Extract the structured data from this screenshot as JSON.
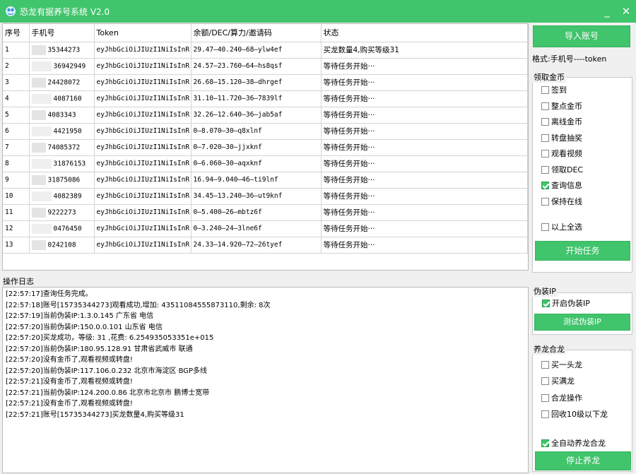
{
  "window": {
    "title": "恐龙有据养号系统 V2.0",
    "minimize": "_",
    "close": "✕"
  },
  "grid": {
    "headers": [
      "序号",
      "手机号",
      "Token",
      "余额/DEC/算力/邀请码",
      "状态"
    ],
    "rows": [
      {
        "no": "1",
        "phone": "35344273",
        "token": "eyJhbGciOiJIUzI1NiIsInR",
        "balance": "29.47—40.240—68—ylw4ef",
        "status": "买龙数量4,购买等级31"
      },
      {
        "no": "2",
        "phone": "36942949",
        "token": "eyJhbGciOiJIUzI1NiIsInR",
        "balance": "24.57—23.760—64—hs8qsf",
        "status": "等待任务开始···"
      },
      {
        "no": "3",
        "phone": "24428072",
        "token": "eyJhbGciOiJIUzI1NiIsInR",
        "balance": "26.68—15.120—38—dhrgef",
        "status": "等待任务开始···"
      },
      {
        "no": "4",
        "phone": "4087160",
        "token": "eyJhbGciOiJIUzI1NiIsInR",
        "balance": "31.10—11.720—36—7839lf",
        "status": "等待任务开始···"
      },
      {
        "no": "5",
        "phone": "4083343",
        "token": "eyJhbGciOiJIUzI1NiIsInR",
        "balance": "32.26—12.640—36—jab5af",
        "status": "等待任务开始···"
      },
      {
        "no": "6",
        "phone": "4421950",
        "token": "eyJhbGciOiJIUzI1NiIsInR",
        "balance": "0—8.070—30—q8xlnf",
        "status": "等待任务开始···"
      },
      {
        "no": "7",
        "phone": "74085372",
        "token": "eyJhbGciOiJIUzI1NiIsInR",
        "balance": "0—7.020—30—jjxknf",
        "status": "等待任务开始···"
      },
      {
        "no": "8",
        "phone": "31876153",
        "token": "eyJhbGciOiJIUzI1NiIsInR",
        "balance": "0—6.060—30—aqxknf",
        "status": "等待任务开始···"
      },
      {
        "no": "9",
        "phone": "31875086",
        "token": "eyJhbGciOiJIUzI1NiIsInR",
        "balance": "16.94—9.040—46—ti9lnf",
        "status": "等待任务开始···"
      },
      {
        "no": "10",
        "phone": "4082389",
        "token": "eyJhbGciOiJIUzI1NiIsInR",
        "balance": "34.45—13.240—36—ut9knf",
        "status": "等待任务开始···"
      },
      {
        "no": "11",
        "phone": "9222273",
        "token": "eyJhbGciOiJIUzI1NiIsInR",
        "balance": "0—5.400—26—mbtz6f",
        "status": "等待任务开始···"
      },
      {
        "no": "12",
        "phone": "0476450",
        "token": "eyJhbGciOiJIUzI1NiIsInR",
        "balance": "0—3.240—24—3lne6f",
        "status": "等待任务开始···"
      },
      {
        "no": "13",
        "phone": "0242108",
        "token": "eyJhbGciOiJIUzI1NiIsInR",
        "balance": "24.33—14.920—72—26tyef",
        "status": "等待任务开始···"
      }
    ]
  },
  "log": {
    "label": "操作日志",
    "lines": [
      "[22:57:17]查询任务完成。",
      "[22:57:18]账号[15735344273]观看成功,增加: 43511084555873110,剩余: 8次",
      "[22:57:19]当前伪装IP:1.3.0.145    广东省 电信",
      "[22:57:20]当前伪装IP:150.0.0.101    山东省 电信",
      "[22:57:20]买龙成功，等级: 31 ,花费: 6.254935053351e+015",
      "[22:57:20]当前伪装IP:180.95.128.91    甘肃省武威市 联通",
      "[22:57:20]没有金币了,观看视频或转盘!",
      "[22:57:20]当前伪装IP:117.106.0.232    北京市海淀区 BGP多线",
      "[22:57:21]没有金币了,观看视频或转盘!",
      "[22:57:21]当前伪装IP:124.200.0.86    北京市北京市 鹏博士宽带",
      "[22:57:21]没有金币了,观看视频或转盘!",
      "[22:57:21]账号[15735344273]买龙数量4,购买等级31"
    ]
  },
  "side": {
    "import_button": "导入账号",
    "format_text": "格式:手机号----token",
    "coins_group": {
      "title": "领取金币",
      "items": [
        {
          "label": "签到",
          "checked": false
        },
        {
          "label": "整点金币",
          "checked": false
        },
        {
          "label": "离线金币",
          "checked": false
        },
        {
          "label": "转盘抽奖",
          "checked": false
        },
        {
          "label": "观看视频",
          "checked": false
        },
        {
          "label": "领取DEC",
          "checked": false
        },
        {
          "label": "查询信息",
          "checked": true
        },
        {
          "label": "保持在线",
          "checked": false
        }
      ],
      "select_all": {
        "label": "以上全选",
        "checked": false
      },
      "start_button": "开始任务"
    },
    "ip_group": {
      "title": "伪装IP",
      "enable": {
        "label": "开启伪装IP",
        "checked": true
      },
      "test_button": "测试伪装IP"
    },
    "dragon_group": {
      "title": "养龙合龙",
      "items": [
        {
          "label": "买一头龙",
          "checked": false
        },
        {
          "label": "买满龙",
          "checked": false
        },
        {
          "label": "合龙操作",
          "checked": false
        },
        {
          "label": "回收10级以下龙",
          "checked": false
        }
      ],
      "auto": {
        "label": "全自动养龙合龙",
        "checked": true
      },
      "stop_button": "停止养龙"
    }
  },
  "colors": {
    "accent": "#40c46c",
    "title_text": "#ffffff"
  }
}
